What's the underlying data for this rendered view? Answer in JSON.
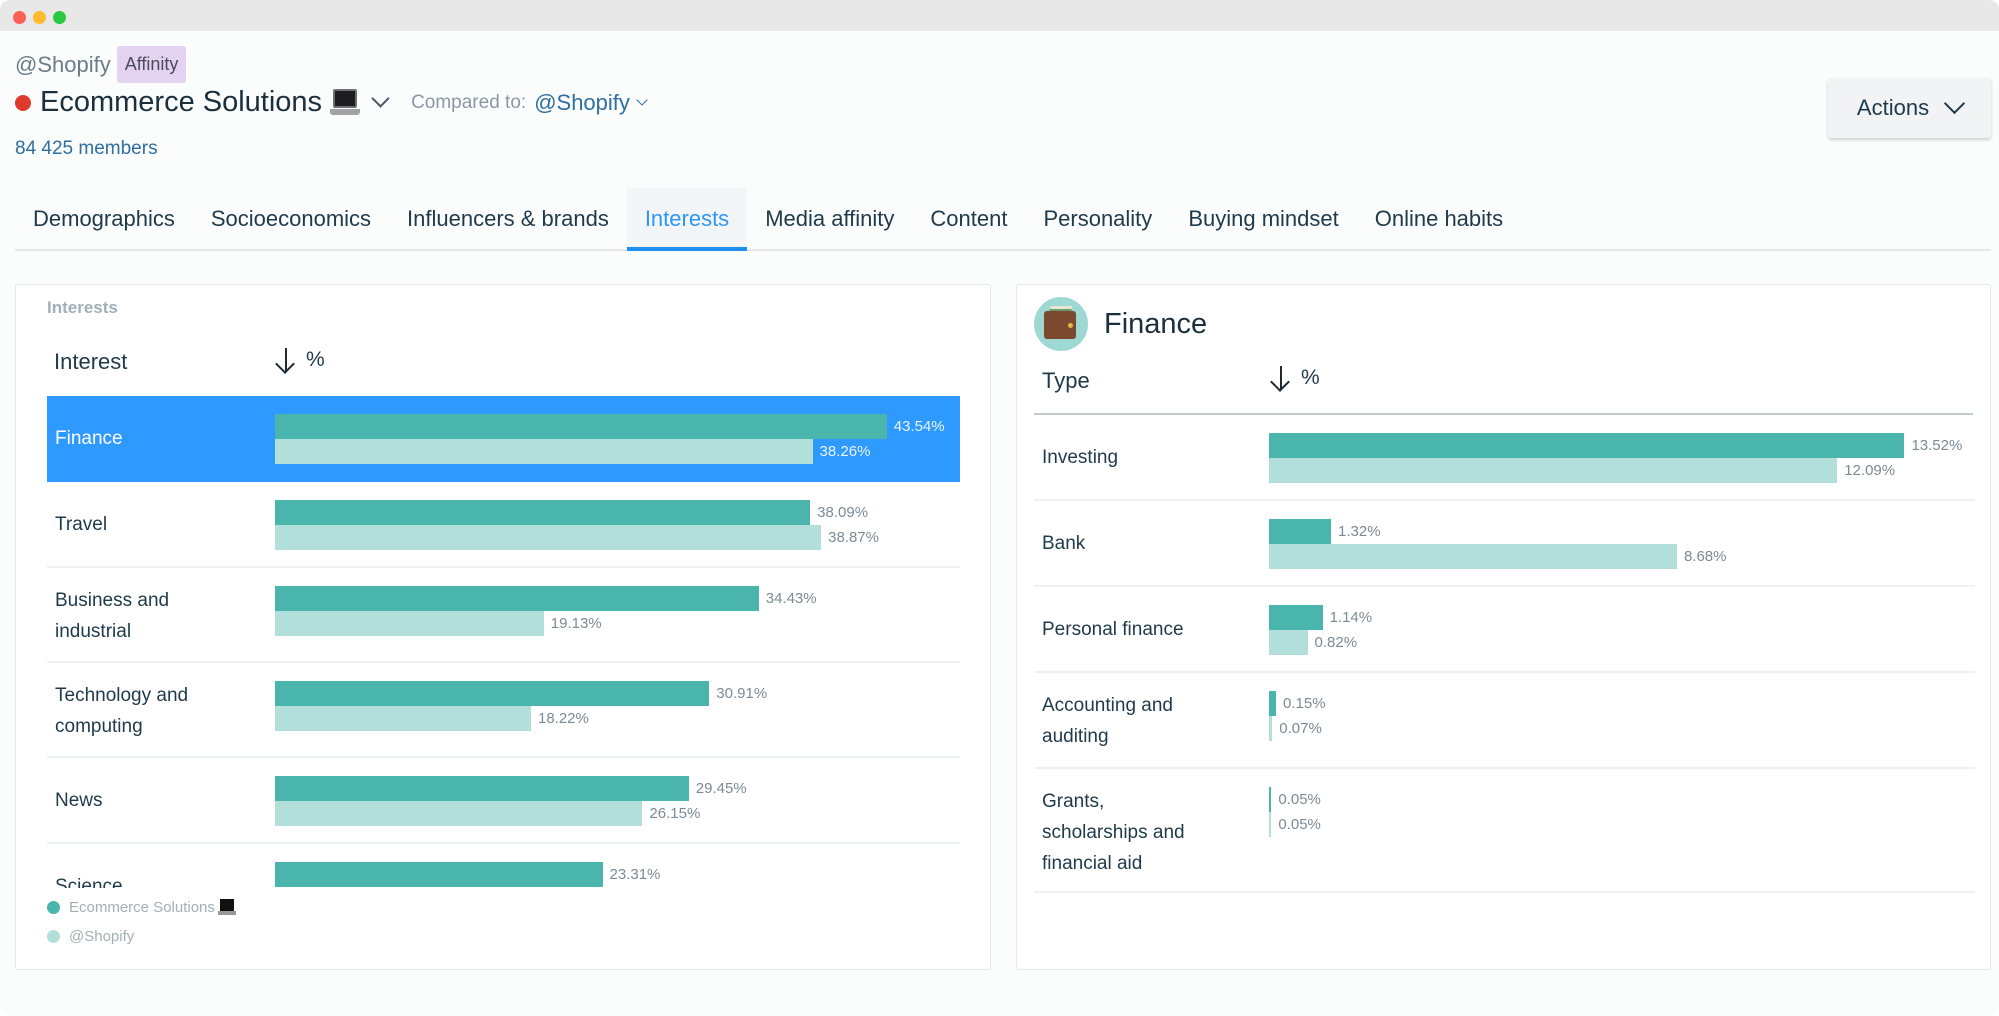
{
  "window": {
    "controls": [
      "close",
      "minimize",
      "zoom"
    ]
  },
  "header": {
    "brand": "@Shopify",
    "badge": "Affinity",
    "title": "Ecommerce Solutions",
    "title_emoji": "laptop-icon",
    "status_color": "#e03a2f",
    "compared_label": "Compared to:",
    "compared_value": "@Shopify",
    "members": "84 425 members",
    "actions_label": "Actions"
  },
  "tabs": [
    {
      "label": "Demographics",
      "active": false
    },
    {
      "label": "Socioeconomics",
      "active": false
    },
    {
      "label": "Influencers & brands",
      "active": false
    },
    {
      "label": "Interests",
      "active": true
    },
    {
      "label": "Media affinity",
      "active": false
    },
    {
      "label": "Content",
      "active": false
    },
    {
      "label": "Personality",
      "active": false
    },
    {
      "label": "Buying mindset",
      "active": false
    },
    {
      "label": "Online habits",
      "active": false
    }
  ],
  "colors": {
    "primary_bar": "#4ab5ac",
    "compare_bar": "#b3dfdb",
    "selected_row": "#2e9aff",
    "accent": "#1e8ef0"
  },
  "interests_panel": {
    "caption": "Interests",
    "col_label": "Interest",
    "col_value": "%",
    "selected": "Finance",
    "legend": [
      {
        "label": "Ecommerce Solutions",
        "color": "#4ab5ac",
        "emoji": "laptop-icon"
      },
      {
        "label": "@Shopify",
        "color": "#b3dfdb"
      }
    ]
  },
  "finance_panel": {
    "title": "Finance",
    "icon": "wallet-icon",
    "col_label": "Type",
    "col_value": "%"
  },
  "chart_data": [
    {
      "type": "bar",
      "title": "Interests",
      "orientation": "horizontal",
      "categories": [
        "Finance",
        "Travel",
        "Business and industrial",
        "Technology and computing",
        "News",
        "Science"
      ],
      "category_lines": [
        [
          "Finance"
        ],
        [
          "Travel"
        ],
        [
          "Business and",
          "industrial"
        ],
        [
          "Technology and",
          "computing"
        ],
        [
          "News"
        ],
        [
          "Science"
        ]
      ],
      "series": [
        {
          "name": "Ecommerce Solutions",
          "values": [
            43.54,
            38.09,
            34.43,
            30.91,
            29.45,
            23.31
          ]
        },
        {
          "name": "@Shopify",
          "values": [
            38.26,
            38.87,
            19.13,
            18.22,
            26.15,
            null
          ]
        }
      ],
      "value_labels": [
        [
          "43.54%",
          "38.26%"
        ],
        [
          "38.09%",
          "38.87%"
        ],
        [
          "34.43%",
          "19.13%"
        ],
        [
          "30.91%",
          "18.22%"
        ],
        [
          "29.45%",
          "26.15%"
        ],
        [
          "23.31%",
          ""
        ]
      ],
      "xlabel": "%",
      "ylabel": "Interest",
      "legend": "bottom-left"
    },
    {
      "type": "bar",
      "title": "Finance",
      "orientation": "horizontal",
      "categories": [
        "Investing",
        "Bank",
        "Personal finance",
        "Accounting and auditing",
        "Grants, scholarships and financial aid"
      ],
      "category_lines": [
        [
          "Investing"
        ],
        [
          "Bank"
        ],
        [
          "Personal finance"
        ],
        [
          "Accounting and",
          "auditing"
        ],
        [
          "Grants,",
          "scholarships and",
          "financial aid"
        ]
      ],
      "series": [
        {
          "name": "Ecommerce Solutions",
          "values": [
            13.52,
            1.32,
            1.14,
            0.15,
            0.05
          ]
        },
        {
          "name": "@Shopify",
          "values": [
            12.09,
            8.68,
            0.82,
            0.07,
            0.05
          ]
        }
      ],
      "value_labels": [
        [
          "13.52%",
          "12.09%"
        ],
        [
          "1.32%",
          "8.68%"
        ],
        [
          "1.14%",
          "0.82%"
        ],
        [
          "0.15%",
          "0.07%"
        ],
        [
          "0.05%",
          "0.05%"
        ]
      ],
      "xlabel": "%",
      "ylabel": "Type"
    }
  ]
}
